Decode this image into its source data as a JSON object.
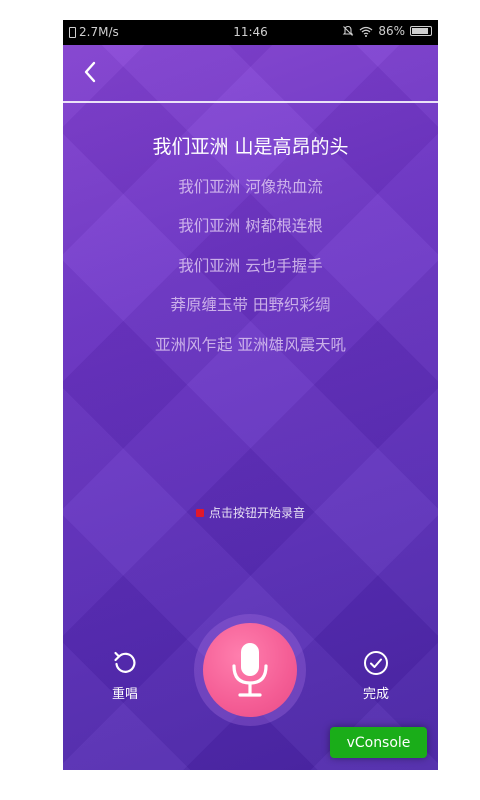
{
  "status_bar": {
    "network_speed": "2.7M/s",
    "time": "11:46",
    "battery": "86%",
    "icons": [
      "sim-icon",
      "mute-icon",
      "wifi-icon",
      "battery-icon"
    ]
  },
  "header": {
    "back_icon": "chevron-left-icon"
  },
  "lyrics": [
    "我们亚洲 山是高昂的头",
    "我们亚洲 河像热血流",
    "我们亚洲 树都根连根",
    "我们亚洲 云也手握手",
    "莽原缠玉带 田野织彩绸",
    "亚洲风乍起 亚洲雄风震天吼"
  ],
  "hint": {
    "text": "点击按钮开始录音",
    "dot_color": "#e2182b"
  },
  "controls": {
    "retry_label": "重唱",
    "done_label": "完成",
    "mic_icon": "microphone-icon"
  },
  "vconsole": {
    "label": "vConsole",
    "color": "#1aad19"
  },
  "colors": {
    "background_top": "#8a46d8",
    "background_bottom": "#4b25a8",
    "mic_button": "#f45d95"
  }
}
